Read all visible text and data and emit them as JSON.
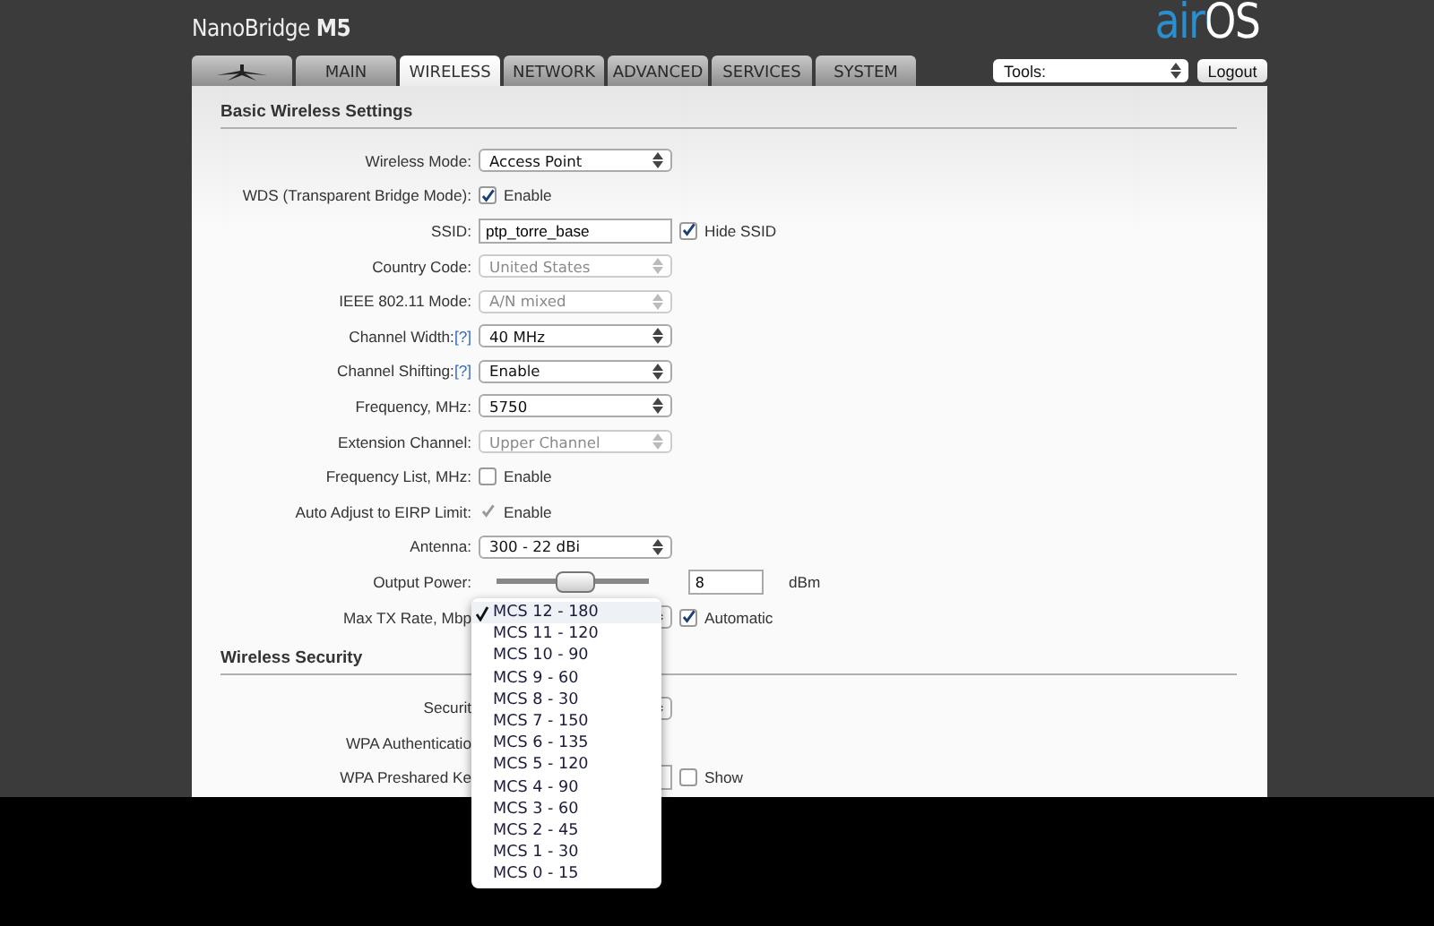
{
  "header": {
    "product": "NanoBridge **M5**",
    "logo": "airOS"
  },
  "tabs": [
    {
      "kind": "icon",
      "selected": false
    },
    {
      "kind": "text",
      "label": "MAIN",
      "selected": false
    },
    {
      "kind": "text",
      "label": "WIRELESS",
      "selected": true
    },
    {
      "kind": "text",
      "label": "NETWORK",
      "selected": false
    },
    {
      "kind": "text",
      "label": "ADVANCED",
      "selected": false
    },
    {
      "kind": "text",
      "label": "SERVICES",
      "selected": false
    },
    {
      "kind": "text",
      "label": "SYSTEM",
      "selected": false
    }
  ],
  "tools": {
    "value": "Tools:"
  },
  "logout": "Logout",
  "sections": [
    {
      "title": "Basic Wireless Settings",
      "rows": [
        {
          "label": "Wireless Mode:",
          "kind": "select",
          "value": "Access Point",
          "disabled": false
        },
        {
          "label": "WDS (Transparent Bridge Mode):",
          "kind": "checkbox",
          "text": "Enable",
          "checked": true,
          "disabled": false
        },
        {
          "label": "SSID:",
          "kind": "text",
          "value": "ptp_torre_base",
          "checkbox": {
            "text": "Hide SSID",
            "checked": true
          }
        },
        {
          "label": "Country Code:",
          "kind": "select",
          "value": "United States",
          "disabled": true
        },
        {
          "label": "IEEE 802.11 Mode:",
          "kind": "select",
          "value": "A/N mixed",
          "disabled": true
        },
        {
          "label": "Channel Width:",
          "help": "[?]",
          "kind": "select",
          "value": "40 MHz",
          "disabled": false
        },
        {
          "label": "Channel Shifting:",
          "help": "[?]",
          "kind": "select",
          "value": "Enable",
          "disabled": false
        },
        {
          "label": "Frequency, MHz:",
          "kind": "select",
          "value": "5750",
          "disabled": false
        },
        {
          "label": "Extension Channel:",
          "kind": "select",
          "value": "Upper Channel",
          "disabled": true
        },
        {
          "label": "Frequency List, MHz:",
          "kind": "checkbox",
          "text": "Enable",
          "checked": false,
          "disabled": false
        },
        {
          "label": "Auto Adjust to EIRP Limit:",
          "kind": "checkbox",
          "text": "Enable",
          "checked": true,
          "disabled": true
        },
        {
          "label": "Antenna:",
          "kind": "select",
          "value": "300 - 22 dBi",
          "disabled": false
        },
        {
          "label": "Output Power:",
          "kind": "slider",
          "level": 0.52,
          "value": "8",
          "unit": "dBm"
        },
        {
          "label": "Max TX Rate, Mbp",
          "kind": "select",
          "disabled": false,
          "checkbox": {
            "text": "Automatic",
            "checked": true
          }
        }
      ]
    },
    {
      "title": "Wireless Security",
      "rows": [
        {
          "label": "Securit",
          "kind": "select",
          "disabled": false
        },
        {
          "label": "WPA Authenticatio",
          "kind": "label"
        },
        {
          "label": "WPA Preshared Ke",
          "kind": "text",
          "checkbox": {
            "text": "Show",
            "checked": false
          }
        }
      ]
    }
  ],
  "dropdown": {
    "options": [
      {
        "label": "MCS 12 - 180",
        "selected": true
      },
      {
        "label": "MCS 11 - 120",
        "selected": false
      },
      {
        "label": "MCS 10 - 90",
        "selected": false
      },
      {
        "label": "MCS 9 - 60",
        "selected": false
      },
      {
        "label": "MCS 8 - 30",
        "selected": false
      },
      {
        "label": "MCS 7 - 150",
        "selected": false
      },
      {
        "label": "MCS 6 - 135",
        "selected": false
      },
      {
        "label": "MCS 5 - 120",
        "selected": false
      },
      {
        "label": "MCS 4 - 90",
        "selected": false
      },
      {
        "label": "MCS 3 - 60",
        "selected": false
      },
      {
        "label": "MCS 2 - 45",
        "selected": false
      },
      {
        "label": "MCS 1 - 30",
        "selected": false
      },
      {
        "label": "MCS 0 - 15",
        "selected": false
      }
    ]
  }
}
